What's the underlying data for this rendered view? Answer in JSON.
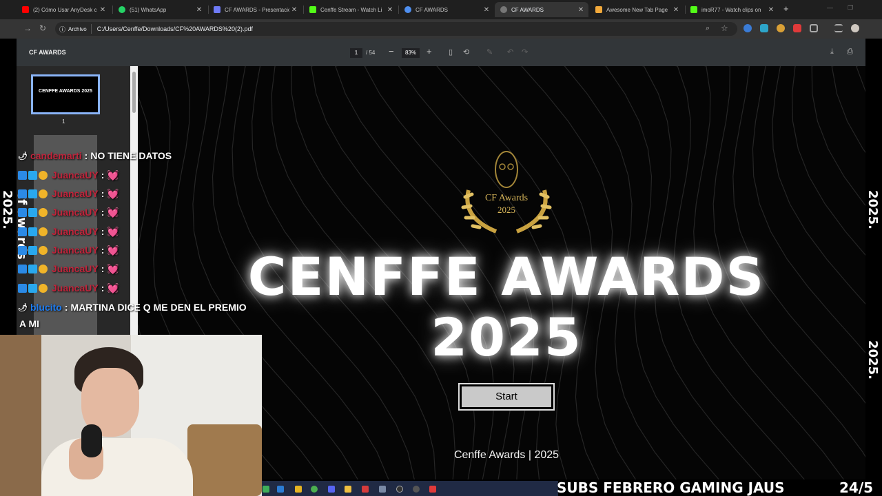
{
  "browser": {
    "tabs": [
      {
        "title": "(2) Cómo Usar AnyDesk c",
        "fav_color": "#ff0000"
      },
      {
        "title": "(51) WhatsApp",
        "fav_color": "#25d366"
      },
      {
        "title": "CF AWARDS - Presentació",
        "fav_color": "#6f7bf7"
      },
      {
        "title": "Cenffe Stream - Watch Li",
        "fav_color": "#53fc18"
      },
      {
        "title": "CF AWARDS",
        "fav_color": "#4f8ff0"
      },
      {
        "title": "CF AWARDS",
        "fav_color": "#777777"
      },
      {
        "title": "Awesome New Tab Page",
        "fav_color": "#f2a93b"
      },
      {
        "title": "imoR77 - Watch clips on",
        "fav_color": "#53fc18"
      }
    ],
    "new_tab": "+",
    "address": {
      "chip": "Archivo",
      "url": "C:/Users/Cenffe/Downloads/CF%20AWARDS%20(2).pdf"
    }
  },
  "pdf": {
    "title": "CF AWARDS",
    "page_current": "1",
    "page_total": "/ 54",
    "zoom": "83%",
    "zoom_minus": "−",
    "zoom_plus": "+",
    "thumb1_label": "1",
    "thumb1_text": "CENFFE AWARDS 2025"
  },
  "slide": {
    "logo_line1": "CF Awards",
    "logo_line2": "2025",
    "title_line1": "CENFFE AWARDS",
    "title_line2": "2025",
    "start_button": "Start",
    "footer": "Cenffe Awards | 2025"
  },
  "overlay": {
    "side_text": "Cf awards 2025.",
    "chat": [
      {
        "user": "candemarti",
        "user_color": "#c0243b",
        "text": "NO TIENE DATOS"
      },
      {
        "user": "JuancaUY",
        "user_color": "#c0243b",
        "text": "💓"
      },
      {
        "user": "JuancaUY",
        "user_color": "#c0243b",
        "text": "💓"
      },
      {
        "user": "JuancaUY",
        "user_color": "#c0243b",
        "text": "💓"
      },
      {
        "user": "JuancaUY",
        "user_color": "#c0243b",
        "text": "💓"
      },
      {
        "user": "JuancaUY",
        "user_color": "#c0243b",
        "text": "💓"
      },
      {
        "user": "JuancaUY",
        "user_color": "#c0243b",
        "text": "💓"
      },
      {
        "user": "JuancaUY",
        "user_color": "#c0243b",
        "text": "💓"
      },
      {
        "user": "blucito",
        "user_color": "#1e7cf0",
        "text": "MARTINA DICE Q ME DEN EL PREMIO"
      }
    ],
    "chat_wrap": "A MI",
    "subs_ticker": "SUBS FEBRERO GAMING JAUS",
    "subs_count": "24/5"
  },
  "colors": {
    "accent_blue": "#8ab4f8",
    "title_white": "#ffffff",
    "gold": "#d8b65a"
  }
}
